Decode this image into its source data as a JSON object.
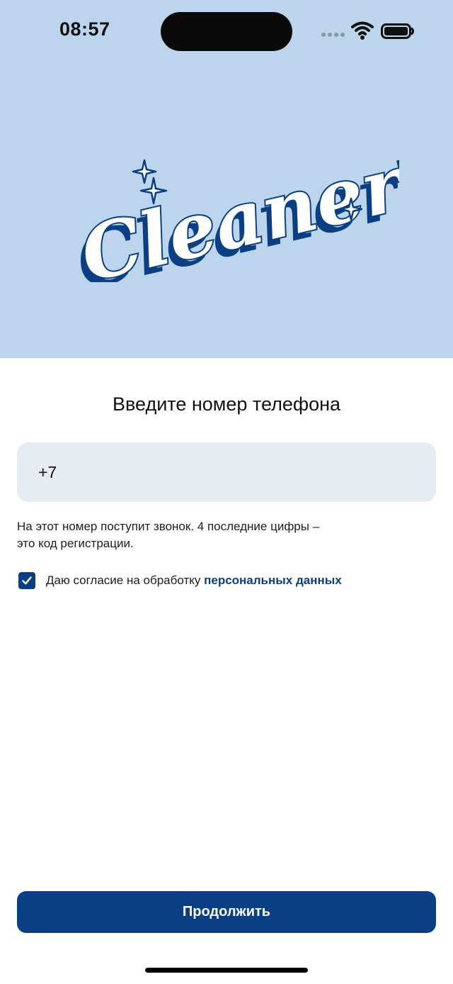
{
  "status_bar": {
    "time": "08:57"
  },
  "brand": {
    "logo_text": "Cleaner's",
    "primary_color": "#0a3f84",
    "header_background": "#bcd5ec"
  },
  "login": {
    "title": "Введите номер телефона",
    "phone_value": "+7",
    "hint_line_1": "На этот номер поступит звонок. 4 последние цифры –",
    "hint_line_2": "это код регистрации.",
    "consent_checked": true,
    "consent_prefix": "Даю согласие на обработку ",
    "consent_link": "персональных данных",
    "continue_label": "Продолжить"
  },
  "icons": [
    "signal-dots-icon",
    "wifi-icon",
    "battery-icon",
    "checkmark-icon",
    "sparkle-icon"
  ]
}
